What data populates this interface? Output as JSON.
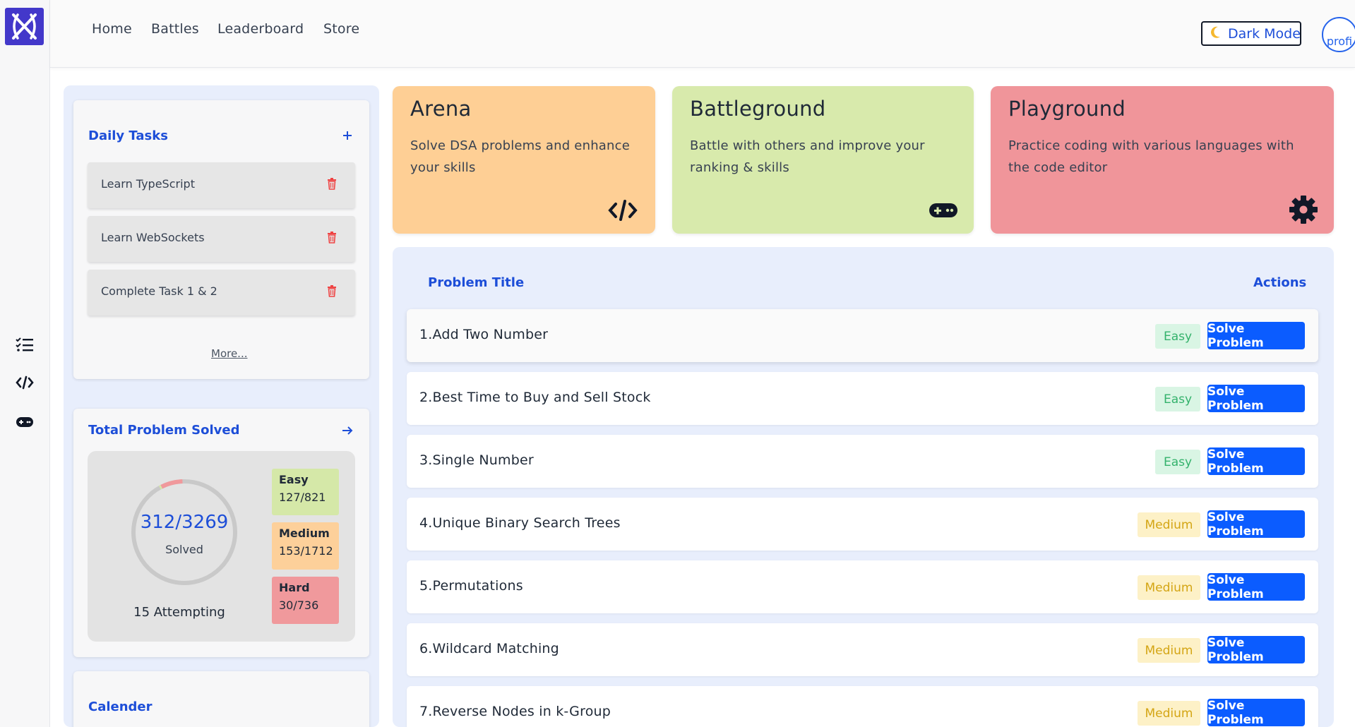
{
  "nav": {
    "items": [
      "Home",
      "Battles",
      "Leaderboard",
      "Store"
    ]
  },
  "header": {
    "dark_mode_label": "Dark Mode",
    "avatar_alt": "profi"
  },
  "daily_tasks": {
    "title": "Daily Tasks",
    "tasks": [
      "Learn TypeScript",
      "Learn WebSockets",
      "Complete Task 1 & 2"
    ],
    "more_label": "More..."
  },
  "total_solved": {
    "title": "Total Problem Solved",
    "solved": "312/3269",
    "solved_label": "Solved",
    "attempting": "15 Attempting",
    "ring_solved_fraction": 0.095,
    "difficulties": [
      {
        "name": "Easy",
        "value": "127/821",
        "color": "#d5e8a8"
      },
      {
        "name": "Medium",
        "value": "153/1712",
        "color": "#fdd09a"
      },
      {
        "name": "Hard",
        "value": "30/736",
        "color": "#f0999c"
      }
    ]
  },
  "calendar": {
    "title": "Calender"
  },
  "modes": [
    {
      "title": "Arena",
      "description": "Solve DSA problems and enhance your skills",
      "icon": "code-icon",
      "color": "#fecf95"
    },
    {
      "title": "Battleground",
      "description": "Battle with others and improve your ranking & skills",
      "icon": "gamepad-icon",
      "color": "#d8eaac"
    },
    {
      "title": "Playground",
      "description": "Practice coding with various languages with the code editor",
      "icon": "gear-icon",
      "color": "#f0959a"
    }
  ],
  "problems": {
    "header_title": "Problem Title",
    "header_actions": "Actions",
    "solve_label": "Solve Problem",
    "rows": [
      {
        "title": "1.Add Two Number",
        "difficulty": "Easy"
      },
      {
        "title": "2.Best Time to Buy and Sell Stock",
        "difficulty": "Easy"
      },
      {
        "title": "3.Single Number",
        "difficulty": "Easy"
      },
      {
        "title": "4.Unique Binary Search Trees",
        "difficulty": "Medium"
      },
      {
        "title": "5.Permutations",
        "difficulty": "Medium"
      },
      {
        "title": "6.Wildcard Matching",
        "difficulty": "Medium"
      },
      {
        "title": "7.Reverse Nodes in k-Group",
        "difficulty": "Medium"
      }
    ]
  },
  "colors": {
    "accent": "#1d4ed8",
    "button": "#0b5cff",
    "panel": "#e8eefc"
  }
}
